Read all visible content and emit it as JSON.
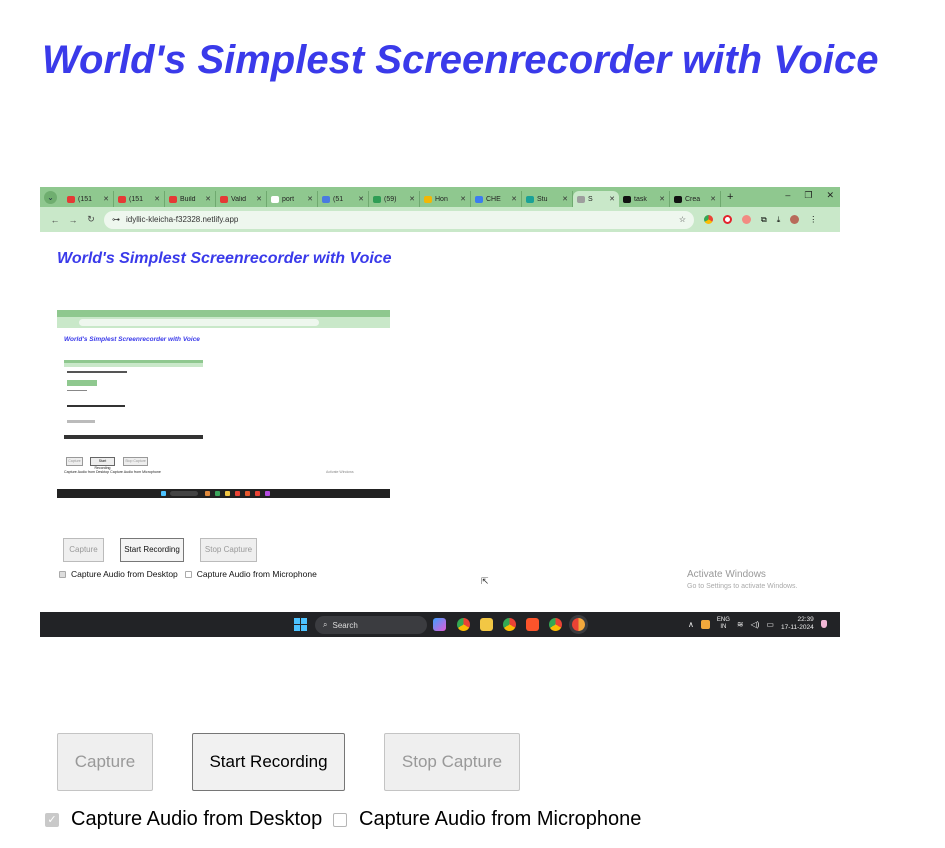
{
  "page": {
    "title": "World's Simplest Screenrecorder with Voice"
  },
  "controls": {
    "capture_label": "Capture",
    "start_label": "Start Recording",
    "stop_label": "Stop Capture",
    "desktop_audio_label": "Capture Audio from Desktop",
    "desktop_audio_checked": true,
    "mic_audio_label": "Capture Audio from Microphone",
    "mic_audio_checked": false
  },
  "preview": {
    "tabs": [
      {
        "label": "(151",
        "favicon_color": "#e53935"
      },
      {
        "label": "(151",
        "favicon_color": "#e53935"
      },
      {
        "label": "Build",
        "favicon_color": "#e53935"
      },
      {
        "label": "Valid",
        "favicon_color": "#e53935"
      },
      {
        "label": "port",
        "favicon_color": "#ffffff"
      },
      {
        "label": "(51",
        "favicon_color": "#4a7be0"
      },
      {
        "label": "(59)",
        "favicon_color": "#2e9d55"
      },
      {
        "label": "Hon",
        "favicon_color": "#f2b705"
      },
      {
        "label": "CHE",
        "favicon_color": "#3c7cf0"
      },
      {
        "label": "Stu",
        "favicon_color": "#1aa197"
      }
    ],
    "active_tab": {
      "label": "S",
      "favicon_color": "#9e9e9e"
    },
    "trailing_tabs": [
      {
        "label": "task",
        "favicon_color": "#111111"
      },
      {
        "label": "Crea",
        "favicon_color": "#111111"
      }
    ],
    "new_tab_symbol": "+",
    "window_controls": [
      "–",
      "❐",
      "✕"
    ],
    "url": "idyllic-kleicha-f32328.netlify.app",
    "nav": [
      "←",
      "→",
      "↻"
    ],
    "title": "World's Simplest Screenrecorder with Voice",
    "nested_title": "World's Simplest Screenrecorder with Voice",
    "nested_capture": "Capture",
    "nested_start": "Start Recording",
    "nested_stop": "Stop Capture",
    "nested_checks": "Capture Audio from Desktop   Capture Audio from Microphone",
    "nested_activate": "Activate Windows",
    "capture_label": "Capture",
    "start_label": "Start Recording",
    "stop_label": "Stop Capture",
    "desktop_audio_label": "Capture Audio from Desktop",
    "mic_audio_label": "Capture Audio from Microphone",
    "activate_title": "Activate Windows",
    "activate_sub": "Go to Settings to activate Windows.",
    "taskbar": {
      "search_label": "Search",
      "lang_top": "ENG",
      "lang_bottom": "IN",
      "time": "22:39",
      "date": "17-11-2024",
      "tray_arrow": "∧"
    }
  }
}
